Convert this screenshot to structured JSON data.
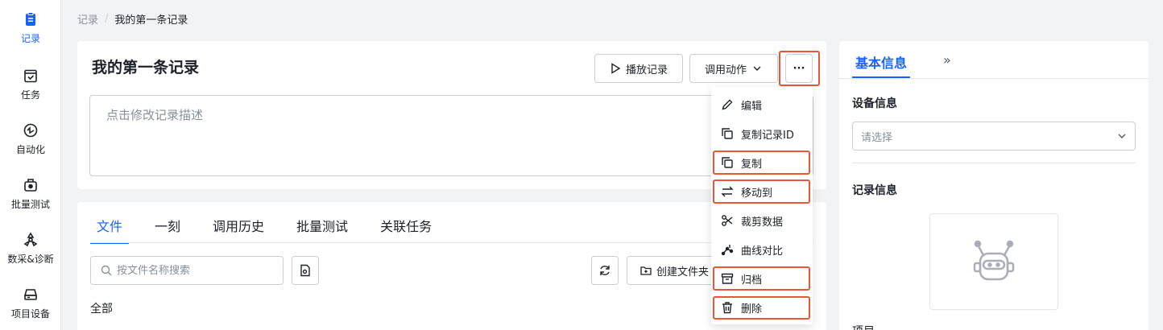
{
  "sidebar": {
    "items": [
      {
        "label": "记录",
        "icon": "clipboard-icon",
        "active": true
      },
      {
        "label": "任务",
        "icon": "calendar-check-icon"
      },
      {
        "label": "自动化",
        "icon": "automation-icon"
      },
      {
        "label": "批量测试",
        "icon": "batch-test-icon"
      },
      {
        "label": "数采&诊断",
        "icon": "radiation-icon"
      },
      {
        "label": "项目设备",
        "icon": "device-icon"
      }
    ]
  },
  "breadcrumb": {
    "parent": "记录",
    "separator": "/",
    "current": "我的第一条记录"
  },
  "record": {
    "title": "我的第一条记录",
    "description_placeholder": "点击修改记录描述",
    "play_label": "播放记录",
    "invoke_label": "调用动作",
    "more_label": "···"
  },
  "tabs": [
    {
      "label": "文件",
      "active": true
    },
    {
      "label": "一刻"
    },
    {
      "label": "调用历史"
    },
    {
      "label": "批量测试"
    },
    {
      "label": "关联任务"
    }
  ],
  "files": {
    "search_placeholder": "按文件名称搜索",
    "create_folder_label": "创建文件夹",
    "filter_label": "全部"
  },
  "menu": {
    "items": [
      {
        "label": "编辑",
        "icon": "pencil-icon"
      },
      {
        "label": "复制记录ID",
        "icon": "copy-icon"
      },
      {
        "label": "复制",
        "icon": "copy-icon"
      },
      {
        "label": "移动到",
        "icon": "swap-arrows-icon"
      },
      {
        "label": "裁剪数据",
        "icon": "scissors-icon"
      },
      {
        "label": "曲线对比",
        "icon": "curve-compare-icon"
      },
      {
        "label": "归档",
        "icon": "archive-icon"
      },
      {
        "label": "删除",
        "icon": "trash-icon"
      }
    ]
  },
  "right_panel": {
    "tab": "基本信息",
    "expand_label": "»",
    "device_section": "设备信息",
    "device_placeholder": "请选择",
    "record_section": "记录信息",
    "project_label": "项目"
  },
  "colors": {
    "accent": "#1664ff",
    "highlight": "#e8563a"
  }
}
